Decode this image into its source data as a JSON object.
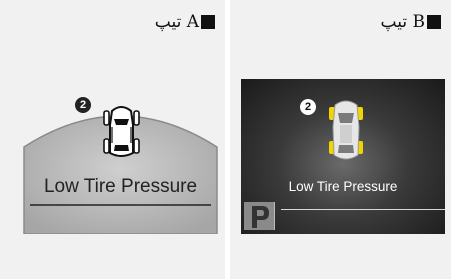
{
  "type_a": {
    "label": "تیپ A",
    "badge": "2",
    "warning_text": "Low Tire Pressure"
  },
  "type_b": {
    "label": "تیپ B",
    "badge": "2",
    "warning_text": "Low Tire Pressure"
  },
  "colors": {
    "tire_warning_b": "#f2d500",
    "dome_fill": "#b9b9b9",
    "screen_bg": "#2a2a2a"
  },
  "icons": {
    "car_top_view": "car-top-view-icon",
    "parking_p": "parking-icon"
  }
}
